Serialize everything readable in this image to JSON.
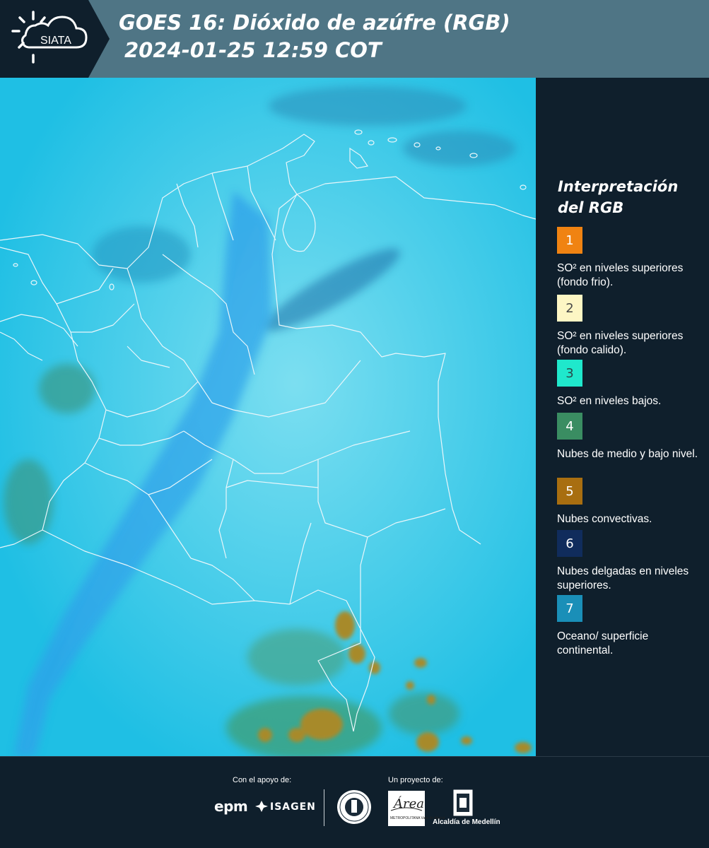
{
  "header": {
    "logo_text": "SIATA",
    "title_line1": "GOES 16: Dióxido de azúfre (RGB)",
    "title_line2": "2024-01-25 12:59 COT"
  },
  "map": {
    "icon": "satellite-rgb-map-colombia",
    "colors": {
      "background": "#1ec3e6",
      "land_haze": "#6ad8ee",
      "borders": "#e8f4f8",
      "convective": "#a78a2a",
      "low_clouds": "#3b9a88"
    }
  },
  "legend": {
    "title": "Interpretación del RGB",
    "items": [
      {
        "number": "1",
        "color": "#f08312",
        "text_color": "#ffffff",
        "label": "SO² en niveles superiores (fondo frio)."
      },
      {
        "number": "2",
        "color": "#fdf6c4",
        "text_color": "#4a4a4a",
        "label": "SO² en niveles superiores (fondo calido)."
      },
      {
        "number": "3",
        "color": "#1fe8cc",
        "text_color": "#2a4a4a",
        "label": "SO² en niveles bajos."
      },
      {
        "number": "4",
        "color": "#3a8d62",
        "text_color": "#ffffff",
        "label": "Nubes de medio y bajo nivel."
      },
      {
        "number": "5",
        "color": "#a86e10",
        "text_color": "#ffffff",
        "label": "Nubes convectivas."
      },
      {
        "number": "6",
        "color": "#102c5c",
        "text_color": "#ffffff",
        "label": "Nubes delgadas en niveles superiores."
      },
      {
        "number": "7",
        "color": "#1a8fb8",
        "text_color": "#ffffff",
        "label": "Oceano/ superficie continental."
      }
    ]
  },
  "footer": {
    "support_label": "Con el apoyo de:",
    "project_label": "Un proyecto de:",
    "epm": "epm",
    "isagen": "ISAGEN",
    "area_name": "Área",
    "area_sub": "METROPOLITANA Valle de Aburrá",
    "alcaldia": "Alcaldía de Medellín"
  }
}
